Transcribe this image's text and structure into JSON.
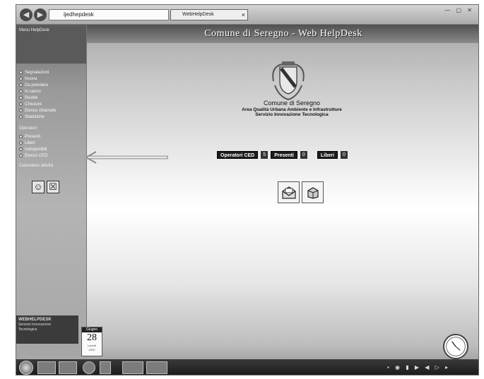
{
  "browser": {
    "address": "ijedhepdesk",
    "tab_title": "WebHelpDesk",
    "tab_close": "×",
    "back_icon": "back-arrow-icon",
    "forward_icon": "forward-arrow-icon"
  },
  "page": {
    "title": "Comune di Seregno - Web HelpDesk"
  },
  "sidebar": {
    "section_1": "Menu HelpDesk",
    "items_1": [
      "Segnalazioni",
      "Nuova",
      "Da prendere",
      "In carico",
      "Risolte",
      "Chiusure",
      "Elenco chiamate",
      "Statistiche"
    ],
    "section_2": "Operatori",
    "items_2": [
      "Presenti",
      "Liberi",
      "Indisponibili",
      "Elenco CED"
    ],
    "section_3": "Calendario attività",
    "footer_title": "WEBHELPDESK",
    "footer_lines": [
      "Servizio Innovazione",
      "Tecnologica"
    ]
  },
  "org": {
    "name": "Comune di Seregno",
    "area": "Area Qualità Urbana Ambiente e Infrastrutture",
    "service": "Servizio Innovazione Tecnologica"
  },
  "status": {
    "operators_label": "Operatori CED",
    "operators_count": "5",
    "present_label": "Presenti",
    "present_count": "0",
    "free_label": "Liberi",
    "free_count": "0"
  },
  "calendar": {
    "month": "Giugno",
    "day": "28",
    "weekday": "Lunedì",
    "year": "2010"
  },
  "colors": {
    "dark_button": "#1c1c1c",
    "sidebar": "#9a9a9a",
    "title_strip": "#505050"
  }
}
